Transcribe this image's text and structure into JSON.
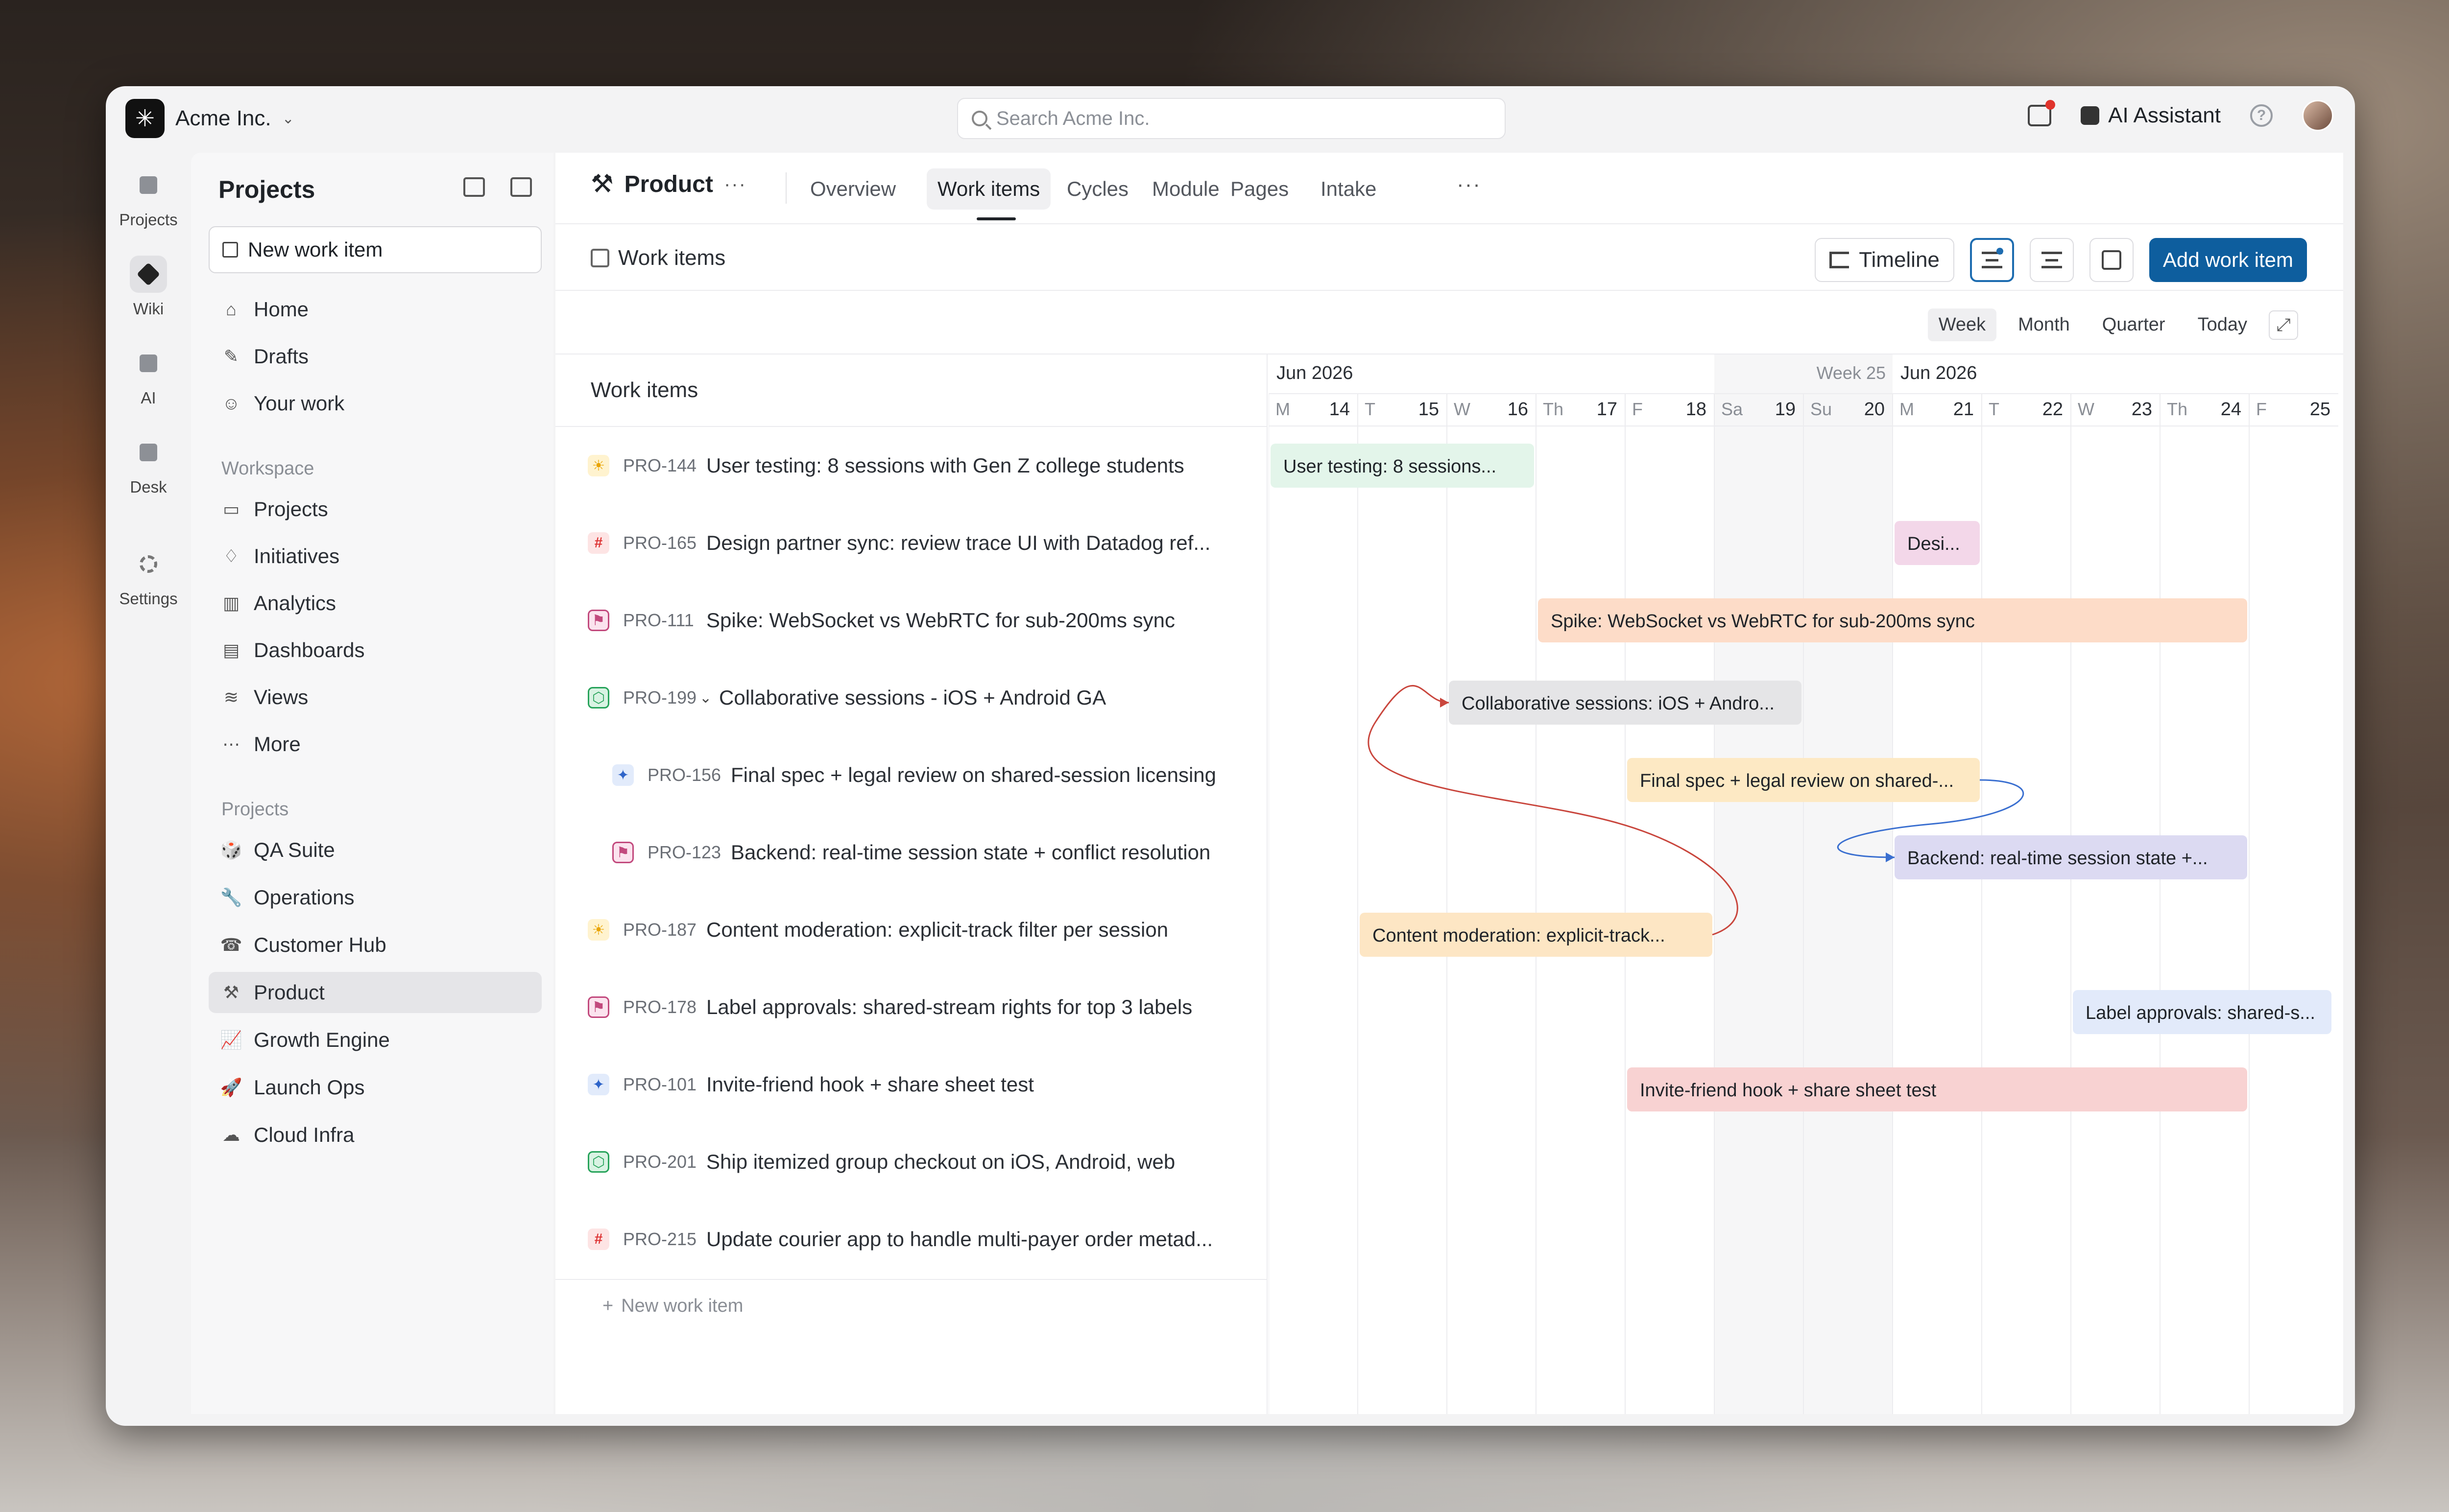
{
  "org": {
    "name": "Acme Inc."
  },
  "search": {
    "placeholder": "Search Acme Inc."
  },
  "topbar": {
    "ai_label": "AI Assistant"
  },
  "rail": {
    "items": [
      {
        "label": "Projects",
        "icon": "projects-icon"
      },
      {
        "label": "Wiki",
        "icon": "wiki-icon",
        "active": true
      },
      {
        "label": "AI",
        "icon": "ai-icon"
      },
      {
        "label": "Desk",
        "icon": "desk-icon"
      },
      {
        "label": "Settings",
        "icon": "settings-icon"
      }
    ]
  },
  "sidebar": {
    "title": "Projects",
    "new_item_label": "New work item",
    "nav": [
      {
        "label": "Home",
        "icon": "⌂"
      },
      {
        "label": "Drafts",
        "icon": "✎"
      },
      {
        "label": "Your work",
        "icon": "☺"
      }
    ],
    "workspace_label": "Workspace",
    "workspace": [
      {
        "label": "Projects",
        "icon": "▭"
      },
      {
        "label": "Initiatives",
        "icon": "♢"
      },
      {
        "label": "Analytics",
        "icon": "▥"
      },
      {
        "label": "Dashboards",
        "icon": "▤"
      },
      {
        "label": "Views",
        "icon": "≋"
      },
      {
        "label": "More",
        "icon": "⋯"
      }
    ],
    "projects_label": "Projects",
    "projects": [
      {
        "label": "QA Suite",
        "emoji": "🎲"
      },
      {
        "label": "Operations",
        "emoji": "🔧"
      },
      {
        "label": "Customer Hub",
        "emoji": "☎"
      },
      {
        "label": "Product",
        "emoji": "⚒",
        "active": true
      },
      {
        "label": "Growth Engine",
        "emoji": "📈"
      },
      {
        "label": "Launch Ops",
        "emoji": "🚀"
      },
      {
        "label": "Cloud Infra",
        "emoji": "☁"
      }
    ]
  },
  "project": {
    "name": "Product",
    "more": "···"
  },
  "tabs": [
    "Overview",
    "Work items",
    "Cycles",
    "Module",
    "Pages",
    "Intake"
  ],
  "active_tab": "Work items",
  "tabs_more": "···",
  "header": {
    "title": "Work items",
    "timeline_label": "Timeline",
    "add_label": "Add work item"
  },
  "ranges": [
    "Week",
    "Month",
    "Quarter",
    "Today"
  ],
  "active_range": "Week",
  "list": {
    "header": "Work items",
    "new_row_label": "New work item",
    "rows": [
      {
        "id": "PRO-144",
        "title": "User testing: 8 sessions with Gen Z college students",
        "icon": "sun",
        "child": false
      },
      {
        "id": "PRO-165",
        "title": "Design partner sync: review trace UI with Datadog ref...",
        "icon": "hash",
        "child": false
      },
      {
        "id": "PRO-111",
        "title": "Spike: WebSocket vs WebRTC for sub-200ms sync",
        "icon": "flag",
        "child": false
      },
      {
        "id": "PRO-199",
        "title": "Collaborative sessions - iOS + Android GA",
        "icon": "cube",
        "child": false,
        "expanded": true
      },
      {
        "id": "PRO-156",
        "title": "Final spec + legal review on shared-session licensing",
        "icon": "spark",
        "child": true
      },
      {
        "id": "PRO-123",
        "title": "Backend: real-time session state + conflict resolution",
        "icon": "flag",
        "child": true
      },
      {
        "id": "PRO-187",
        "title": "Content moderation: explicit-track filter per session",
        "icon": "sun",
        "child": false
      },
      {
        "id": "PRO-178",
        "title": "Label approvals: shared-stream rights for top 3 labels",
        "icon": "flag",
        "child": false
      },
      {
        "id": "PRO-101",
        "title": "Invite-friend hook + share sheet test",
        "icon": "spark",
        "child": false
      },
      {
        "id": "PRO-201",
        "title": "Ship itemized group checkout on iOS, Android, web",
        "icon": "cube",
        "child": false
      },
      {
        "id": "PRO-215",
        "title": "Update courier app to handle multi-payer order metad...",
        "icon": "hash",
        "child": false
      }
    ]
  },
  "timeline": {
    "month_labels": [
      {
        "text": "Jun 2026",
        "day_index": 0
      },
      {
        "text": "Week 25",
        "day_index": 6,
        "align": "end"
      },
      {
        "text": "Jun  2026",
        "day_index": 7
      }
    ],
    "days": [
      {
        "dow": "M",
        "num": "14"
      },
      {
        "dow": "T",
        "num": "15"
      },
      {
        "dow": "W",
        "num": "16"
      },
      {
        "dow": "Th",
        "num": "17"
      },
      {
        "dow": "F",
        "num": "18"
      },
      {
        "dow": "Sa",
        "num": "19",
        "weekend": true
      },
      {
        "dow": "Su",
        "num": "20",
        "weekend": true
      },
      {
        "dow": "M",
        "num": "21"
      },
      {
        "dow": "T",
        "num": "22"
      },
      {
        "dow": "W",
        "num": "23"
      },
      {
        "dow": "Th",
        "num": "24"
      },
      {
        "dow": "F",
        "num": "25"
      }
    ],
    "bars": [
      {
        "row": 0,
        "start": "2026-06-14",
        "end": "2026-06-16",
        "label": "User testing: 8 sessions...",
        "fill": "#e3f5ea",
        "text": "#1f2328"
      },
      {
        "row": 1,
        "start": "2026-06-21",
        "end": "2026-06-21",
        "label": "Desi...",
        "fill": "#f3d7e9",
        "text": "#1f2328"
      },
      {
        "row": 2,
        "start": "2026-06-17",
        "end": "2026-06-24",
        "label": "Spike: WebSocket vs WebRTC for sub-200ms sync",
        "fill": "#fddcc8",
        "text": "#1f2328"
      },
      {
        "row": 3,
        "start": "2026-06-16",
        "end": "2026-06-19",
        "label": "Collaborative sessions: iOS + Andro...",
        "fill": "#e5e5e7",
        "text": "#1f2328"
      },
      {
        "row": 4,
        "start": "2026-06-18",
        "end": "2026-06-21",
        "label": "Final spec + legal review on shared-...",
        "fill": "#fde9c4",
        "text": "#1f2328"
      },
      {
        "row": 5,
        "start": "2026-06-21",
        "end": "2026-06-24",
        "label": "Backend: real-time session state +...",
        "fill": "#dcdaf2",
        "text": "#1f2328"
      },
      {
        "row": 6,
        "start": "2026-06-15",
        "end": "2026-06-18",
        "label": "Content moderation: explicit-track...",
        "fill": "#fde6c4",
        "text": "#1f2328"
      },
      {
        "row": 7,
        "start": "2026-06-23",
        "end": "2026-06-25",
        "label": "Label approvals: shared-s...",
        "fill": "#e2eafa",
        "text": "#1f2328"
      },
      {
        "row": 8,
        "start": "2026-06-18",
        "end": "2026-06-24",
        "label": "Invite-friend hook + share sheet test",
        "fill": "#f8d2d2",
        "text": "#1f2328"
      }
    ],
    "dependencies": [
      {
        "from_row": 6,
        "to_row": 3,
        "color": "#c9463d"
      },
      {
        "from_row": 4,
        "to_row": 5,
        "color": "#3a6fd0"
      }
    ]
  }
}
